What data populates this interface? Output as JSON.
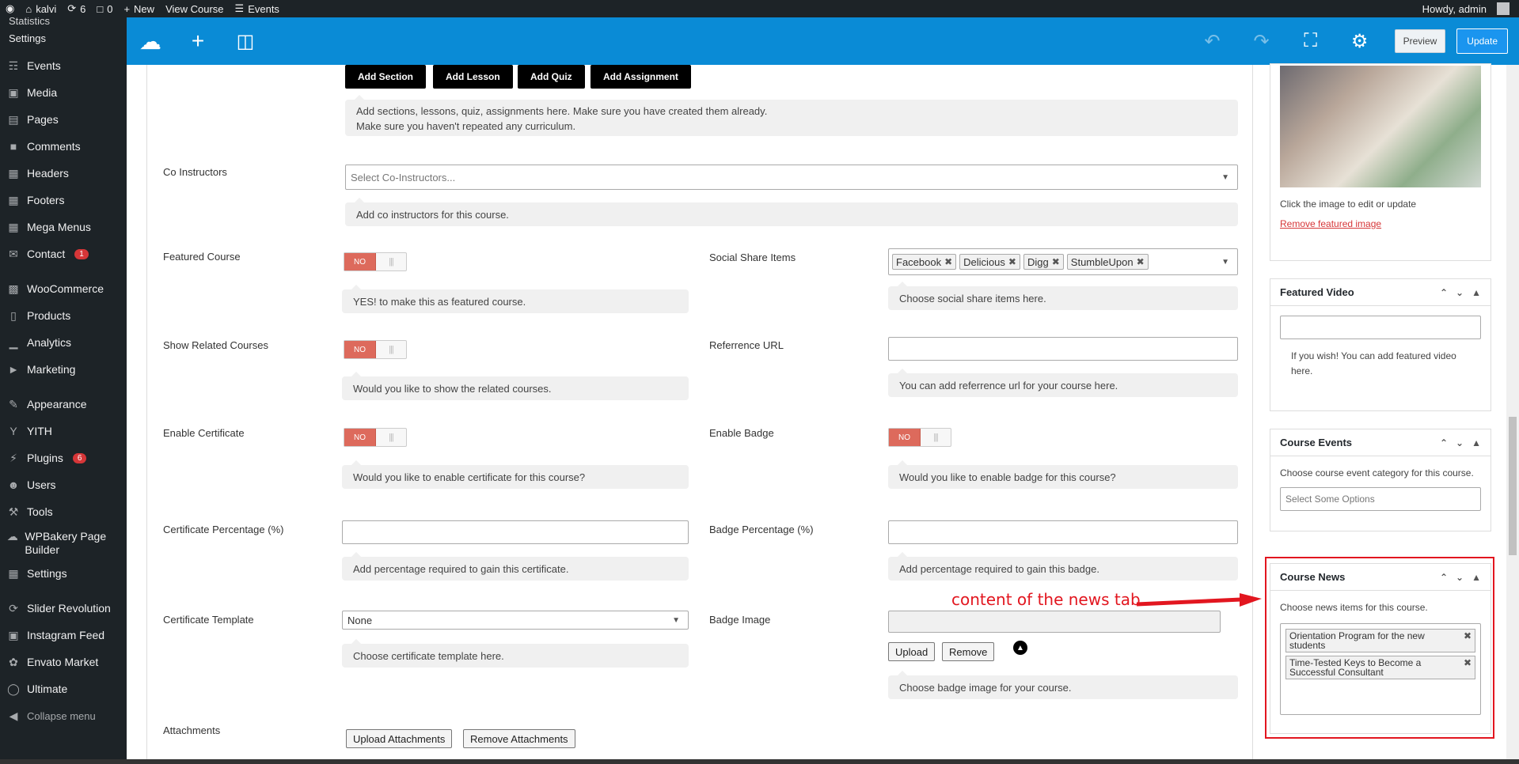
{
  "adminbar": {
    "site": "kalvi",
    "updates": "6",
    "comments": "0",
    "new": "New",
    "view_course": "View Course",
    "events": "Events",
    "howdy": "Howdy, admin"
  },
  "sidebar": {
    "sub_items": [
      "Statistics",
      "Settings"
    ],
    "items": [
      {
        "label": "Events",
        "icon": "events-icon"
      },
      {
        "label": "Media",
        "icon": "media-icon"
      },
      {
        "label": "Pages",
        "icon": "pages-icon"
      },
      {
        "label": "Comments",
        "icon": "comments-icon"
      },
      {
        "label": "Headers",
        "icon": "grid-icon"
      },
      {
        "label": "Footers",
        "icon": "grid-icon"
      },
      {
        "label": "Mega Menus",
        "icon": "grid-icon"
      },
      {
        "label": "Contact",
        "icon": "mail-icon",
        "badge": "1"
      },
      {
        "label": "WooCommerce",
        "icon": "woo-icon"
      },
      {
        "label": "Products",
        "icon": "products-icon"
      },
      {
        "label": "Analytics",
        "icon": "analytics-icon"
      },
      {
        "label": "Marketing",
        "icon": "megaphone-icon"
      },
      {
        "label": "Appearance",
        "icon": "brush-icon"
      },
      {
        "label": "YITH",
        "icon": "yith-icon"
      },
      {
        "label": "Plugins",
        "icon": "plugins-icon",
        "badge": "6"
      },
      {
        "label": "Users",
        "icon": "users-icon"
      },
      {
        "label": "Tools",
        "icon": "tools-icon"
      },
      {
        "label": "WPBakery Page Builder",
        "icon": "wpbakery-icon"
      },
      {
        "label": "Settings",
        "icon": "settings-icon"
      },
      {
        "label": "Slider Revolution",
        "icon": "slider-icon"
      },
      {
        "label": "Instagram Feed",
        "icon": "instagram-icon"
      },
      {
        "label": "Envato Market",
        "icon": "envato-icon"
      },
      {
        "label": "Ultimate",
        "icon": "ultimate-icon"
      },
      {
        "label": "Collapse menu",
        "icon": "collapse-icon"
      }
    ]
  },
  "toolbar": {
    "preview": "Preview",
    "update": "Update"
  },
  "curriculum": {
    "buttons": [
      "Add Section",
      "Add Lesson",
      "Add Quiz",
      "Add Assignment"
    ],
    "help_line1": "Add sections, lessons, quiz, assignments here. Make sure you have created them already.",
    "help_line2": "Make sure you haven't repeated any curriculum."
  },
  "co_instructors": {
    "label": "Co Instructors",
    "placeholder": "Select Co-Instructors...",
    "help": "Add co instructors for this course."
  },
  "featured_course": {
    "label": "Featured Course",
    "toggle": "NO",
    "help": "YES! to make this as featured course."
  },
  "social_share": {
    "label": "Social Share Items",
    "tags": [
      "Facebook",
      "Delicious",
      "Digg",
      "StumbleUpon"
    ],
    "help": "Choose social share items here."
  },
  "related_courses": {
    "label": "Show Related Courses",
    "toggle": "NO",
    "help": "Would you like to show the related courses."
  },
  "reference_url": {
    "label": "Referrence URL",
    "help": "You can add referrence url for your course here."
  },
  "enable_certificate": {
    "label": "Enable Certificate",
    "toggle": "NO",
    "help": "Would you like to enable certificate for this course?"
  },
  "enable_badge": {
    "label": "Enable Badge",
    "toggle": "NO",
    "help": "Would you like to enable badge for this course?"
  },
  "certificate_percentage": {
    "label": "Certificate Percentage (%)",
    "help": "Add percentage required to gain this certificate."
  },
  "badge_percentage": {
    "label": "Badge Percentage (%)",
    "help": "Add percentage required to gain this badge."
  },
  "certificate_template": {
    "label": "Certificate Template",
    "value": "None",
    "help": "Choose certificate template here."
  },
  "badge_image": {
    "label": "Badge Image",
    "upload": "Upload",
    "remove": "Remove",
    "help": "Choose badge image for your course."
  },
  "attachments": {
    "label": "Attachments",
    "upload": "Upload Attachments",
    "remove": "Remove Attachments"
  },
  "featured_image": {
    "help": "Click the image to edit or update",
    "remove_link": "Remove featured image"
  },
  "featured_video": {
    "title": "Featured Video",
    "help": "If you wish! You can add featured video here."
  },
  "course_events": {
    "title": "Course Events",
    "help": "Choose course event category for this course.",
    "placeholder": "Select Some Options"
  },
  "course_news": {
    "title": "Course News",
    "help": "Choose news items for this course.",
    "items": [
      "Orientation Program for the new students",
      "Time-Tested Keys to Become a Successful Consultant"
    ]
  },
  "annotation": "content of the news tab",
  "colors": {
    "admin_dark": "#1d2327",
    "toolbar_blue": "#0a8bd6",
    "toggle_red": "#dd6a5c",
    "annotation_red": "#e2161f"
  }
}
